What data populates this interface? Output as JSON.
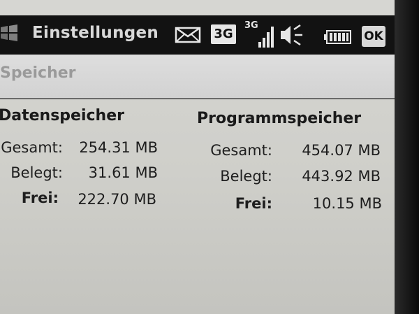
{
  "statusbar": {
    "title": "Einstellungen",
    "network_badge": "3G",
    "signal_badge": "3G",
    "ok_label": "OK"
  },
  "section": {
    "title": "Speicher"
  },
  "data_storage": {
    "title": "Datenspeicher",
    "rows": [
      {
        "label": "Gesamt:",
        "value": "254.31 MB",
        "bold": false
      },
      {
        "label": "Belegt:",
        "value": "31.61 MB",
        "bold": false
      },
      {
        "label": "Frei:",
        "value": "222.70 MB",
        "bold": true
      }
    ]
  },
  "program_storage": {
    "title": "Programmspeicher",
    "rows": [
      {
        "label": "Gesamt:",
        "value": "454.07 MB",
        "bold": false
      },
      {
        "label": "Belegt:",
        "value": "443.92 MB",
        "bold": false
      },
      {
        "label": "Frei:",
        "value": "10.15 MB",
        "bold": true
      }
    ]
  },
  "icons": [
    "windows-logo-icon",
    "mail-icon",
    "3g-icon",
    "3g-signal-icon",
    "speaker-icon",
    "battery-icon"
  ]
}
